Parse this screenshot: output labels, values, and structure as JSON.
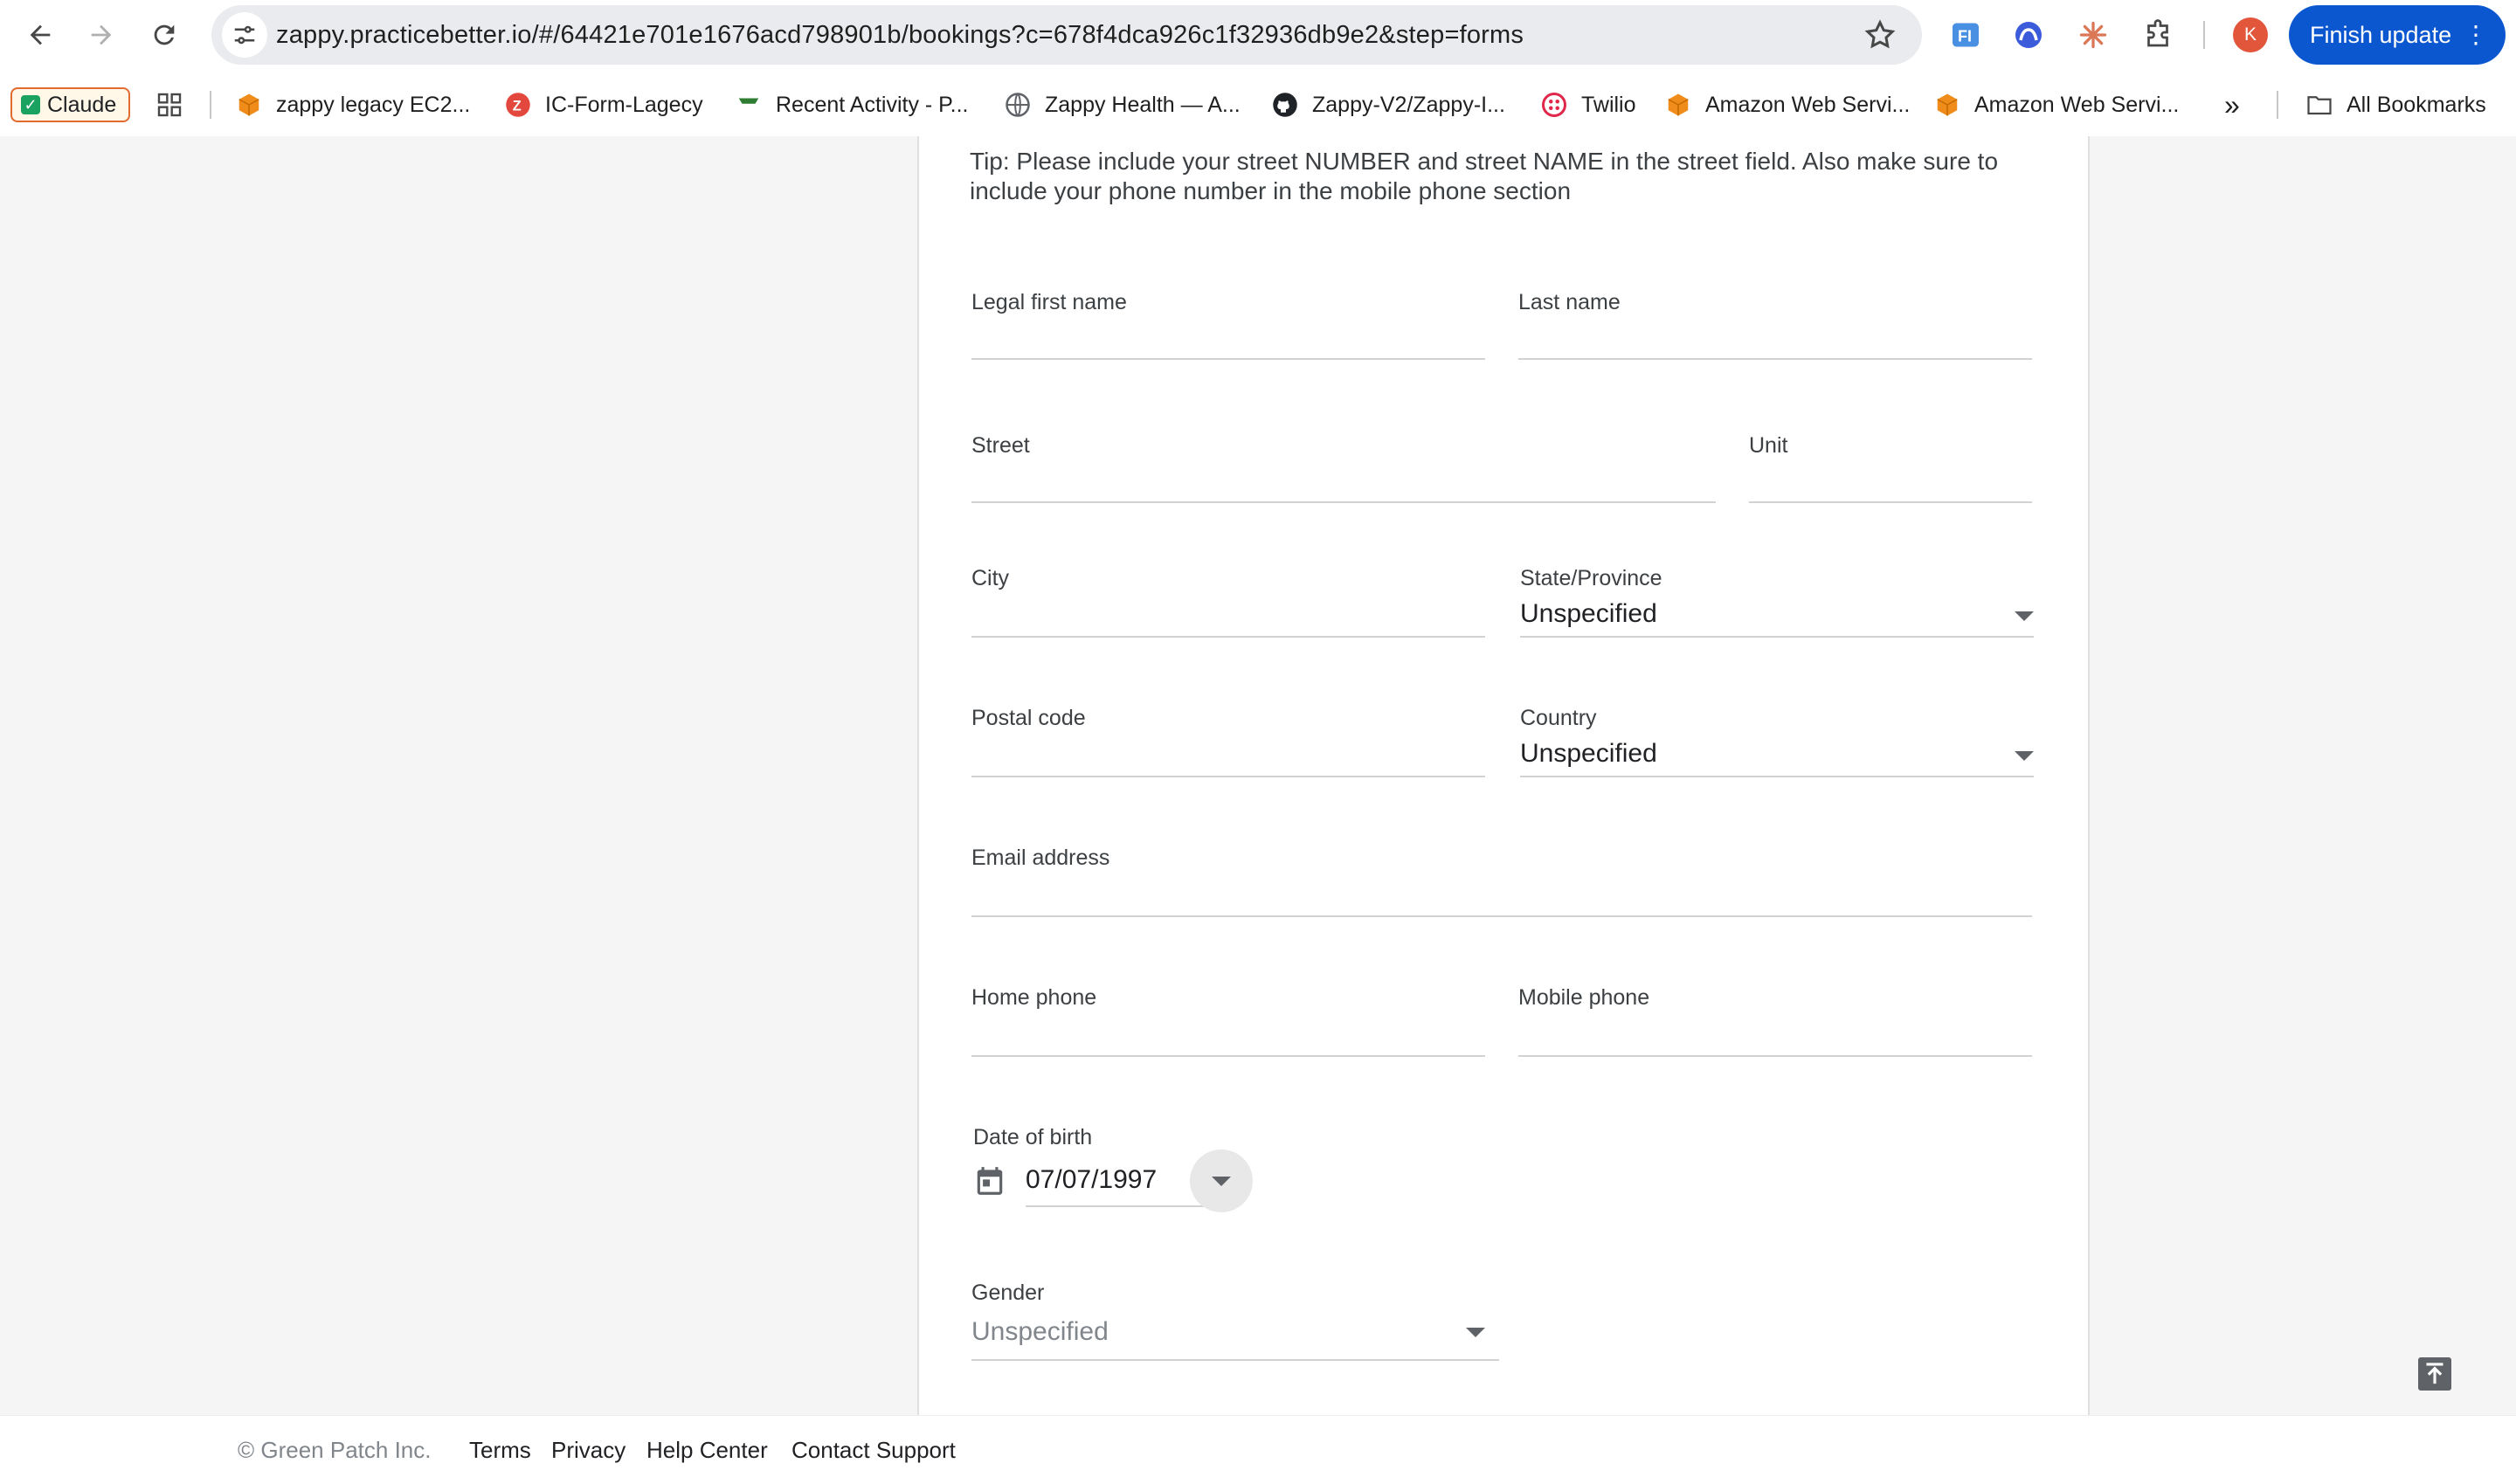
{
  "browser": {
    "url": "zappy.practicebetter.io/#/64421e701e1676acd798901b/bookings?c=678f4dca926c1f32936db9e2&step=forms",
    "profile_initial": "K",
    "finish_update_label": "Finish update",
    "bookmarks": [
      {
        "label": "Claude",
        "icon": "check-icon"
      },
      {
        "label": "zappy legacy EC2...",
        "icon": "aws-icon"
      },
      {
        "label": "IC-Form-Lagecy",
        "icon": "zapier-icon"
      },
      {
        "label": "Recent Activity - P...",
        "icon": "green-flag-icon"
      },
      {
        "label": "Zappy Health — A...",
        "icon": "globe-icon"
      },
      {
        "label": "Zappy-V2/Zappy-I...",
        "icon": "github-icon"
      },
      {
        "label": "Twilio",
        "icon": "twilio-icon"
      },
      {
        "label": "Amazon Web Servi...",
        "icon": "aws-icon"
      },
      {
        "label": "Amazon Web Servi...",
        "icon": "aws-icon"
      }
    ],
    "all_bookmarks_label": "All Bookmarks",
    "overflow_label": "»"
  },
  "form": {
    "tip": "Tip: Please include your street NUMBER and street NAME in the street field. Also make sure to include your phone number in the mobile phone section",
    "fields": {
      "first_name": {
        "label": "Legal first name",
        "value": ""
      },
      "last_name": {
        "label": "Last name",
        "value": ""
      },
      "street": {
        "label": "Street",
        "value": ""
      },
      "unit": {
        "label": "Unit",
        "value": ""
      },
      "city": {
        "label": "City",
        "value": ""
      },
      "state": {
        "label": "State/Province",
        "value": "Unspecified"
      },
      "postal": {
        "label": "Postal code",
        "value": ""
      },
      "country": {
        "label": "Country",
        "value": "Unspecified"
      },
      "email": {
        "label": "Email address",
        "value": ""
      },
      "home_phone": {
        "label": "Home phone",
        "value": ""
      },
      "mobile_phone": {
        "label": "Mobile phone",
        "value": ""
      },
      "dob": {
        "label": "Date of birth",
        "value": "07/07/1997"
      },
      "gender": {
        "label": "Gender",
        "value": "Unspecified"
      }
    }
  },
  "footer": {
    "copyright": "© Green Patch Inc.",
    "links": [
      "Terms",
      "Privacy",
      "Help Center",
      "Contact Support"
    ]
  },
  "colors": {
    "accent": "#0b57d0",
    "avatar": "#e2563b",
    "card_bg": "#ffffff",
    "page_bg": "#f5f5f5"
  }
}
